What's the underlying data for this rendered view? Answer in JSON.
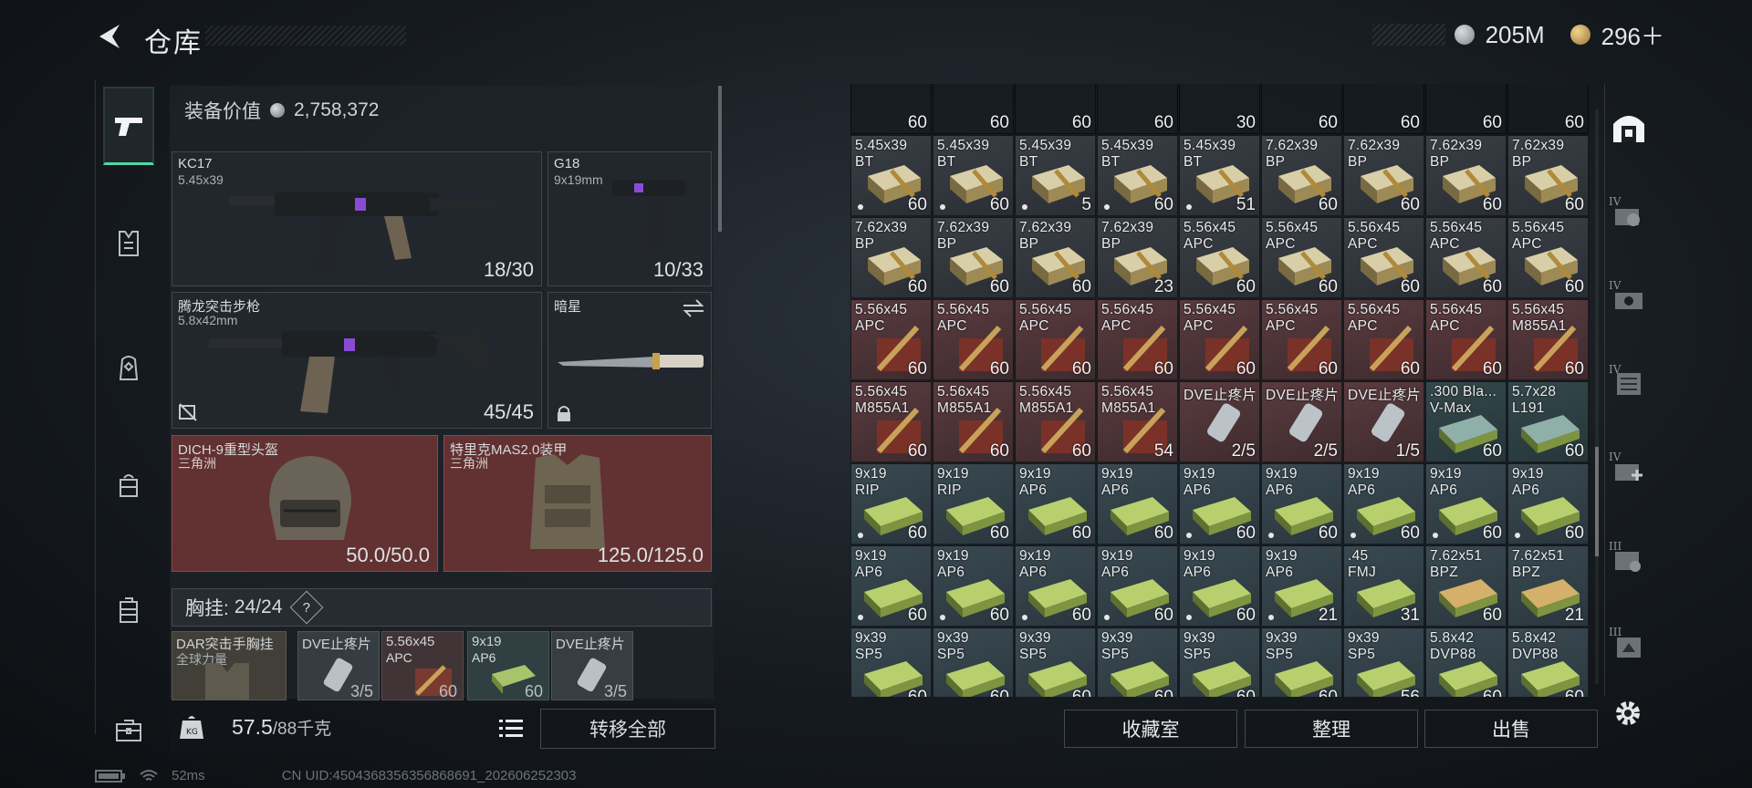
{
  "header": {
    "title": "仓库"
  },
  "currency": {
    "silver": "205M",
    "gold": "296＋",
    "silver_color": "#9aa1a6",
    "gold_color": "#c9a15a"
  },
  "nav": {
    "items": [
      "gun-icon",
      "vest-icon",
      "backpack-icon",
      "bag-icon",
      "case-icon",
      "toolbox-icon"
    ],
    "active_index": 0
  },
  "equipment": {
    "value_label": "装备价值",
    "value": "2,758,372",
    "weapons": [
      {
        "name": "KC17",
        "caliber": "5.45x39",
        "ammo": "18/30"
      },
      {
        "name": "G18",
        "caliber": "9x19mm",
        "ammo": "10/33"
      },
      {
        "name": "腾龙突击步枪",
        "caliber": "5.8x42mm",
        "ammo": "45/45"
      },
      {
        "name": "暗星",
        "caliber": "",
        "ammo": ""
      }
    ],
    "helmet": {
      "name": "DICH-9重型头盔",
      "origin": "三角洲",
      "durability": "50.0/50.0"
    },
    "armor": {
      "name": "特里克MAS2.0装甲",
      "origin": "三角洲",
      "durability": "125.0/125.0"
    },
    "chest_rig": {
      "label": "胸挂:",
      "capacity": "24/24",
      "help": "?"
    },
    "rig_slots": [
      {
        "name": "DAR突击手胸挂",
        "sub": "全球力量",
        "count": ""
      },
      {
        "name": "DVE止疼片",
        "sub": "",
        "count": "3/5"
      },
      {
        "name": "5.56x45",
        "sub": "APC",
        "count": "60"
      },
      {
        "name": "9x19",
        "sub": "AP6",
        "count": "60"
      },
      {
        "name": "DVE止疼片",
        "sub": "",
        "count": "3/5"
      }
    ],
    "weight": "57.5",
    "weight_max": "/88千克",
    "transfer_all": "转移全部"
  },
  "stash": {
    "top_row_counts": [
      "60",
      "60",
      "60",
      "60",
      "30",
      "60",
      "60",
      "60",
      "60"
    ],
    "rows": [
      [
        [
          "5.45x39",
          "BT",
          "60",
          "dark",
          true
        ],
        [
          "5.45x39",
          "BT",
          "60",
          "dark",
          true
        ],
        [
          "5.45x39",
          "BT",
          "5",
          "dark",
          true
        ],
        [
          "5.45x39",
          "BT",
          "60",
          "dark",
          true
        ],
        [
          "5.45x39",
          "BT",
          "51",
          "dark",
          true
        ],
        [
          "7.62x39",
          "BP",
          "60",
          "dark",
          false
        ],
        [
          "7.62x39",
          "BP",
          "60",
          "dark",
          false
        ],
        [
          "7.62x39",
          "BP",
          "60",
          "dark",
          false
        ],
        [
          "7.62x39",
          "BP",
          "60",
          "dark",
          false
        ]
      ],
      [
        [
          "7.62x39",
          "BP",
          "60",
          "dark",
          false
        ],
        [
          "7.62x39",
          "BP",
          "60",
          "dark",
          false
        ],
        [
          "7.62x39",
          "BP",
          "60",
          "dark",
          false
        ],
        [
          "7.62x39",
          "BP",
          "23",
          "dark",
          false
        ],
        [
          "5.56x45",
          "APC",
          "60",
          "dark",
          false
        ],
        [
          "5.56x45",
          "APC",
          "60",
          "dark",
          false
        ],
        [
          "5.56x45",
          "APC",
          "60",
          "dark",
          false
        ],
        [
          "5.56x45",
          "APC",
          "60",
          "dark",
          false
        ],
        [
          "5.56x45",
          "APC",
          "60",
          "dark",
          false
        ]
      ],
      [
        [
          "5.56x45",
          "APC",
          "60",
          "red",
          false
        ],
        [
          "5.56x45",
          "APC",
          "60",
          "red",
          false
        ],
        [
          "5.56x45",
          "APC",
          "60",
          "red",
          false
        ],
        [
          "5.56x45",
          "APC",
          "60",
          "red",
          false
        ],
        [
          "5.56x45",
          "APC",
          "60",
          "red",
          false
        ],
        [
          "5.56x45",
          "APC",
          "60",
          "red",
          false
        ],
        [
          "5.56x45",
          "APC",
          "60",
          "red",
          false
        ],
        [
          "5.56x45",
          "APC",
          "60",
          "red",
          false
        ],
        [
          "5.56x45",
          "M855A1",
          "60",
          "red",
          false
        ]
      ],
      [
        [
          "5.56x45",
          "M855A1",
          "60",
          "red",
          false
        ],
        [
          "5.56x45",
          "M855A1",
          "60",
          "red",
          false
        ],
        [
          "5.56x45",
          "M855A1",
          "60",
          "red",
          false
        ],
        [
          "5.56x45",
          "M855A1",
          "54",
          "red",
          false
        ],
        [
          "DVE止疼片",
          "",
          "2/5",
          "red",
          false
        ],
        [
          "DVE止疼片",
          "",
          "2/5",
          "red",
          false
        ],
        [
          "DVE止疼片",
          "",
          "1/5",
          "red",
          false
        ],
        [
          ".300 Bla...",
          "V-Max",
          "60",
          "teal",
          false
        ],
        [
          "5.7x28",
          "L191",
          "60",
          "teal",
          false
        ]
      ],
      [
        [
          "9x19",
          "RIP",
          "60",
          "green",
          true
        ],
        [
          "9x19",
          "RIP",
          "60",
          "green",
          false
        ],
        [
          "9x19",
          "AP6",
          "60",
          "green",
          false
        ],
        [
          "9x19",
          "AP6",
          "60",
          "green",
          false
        ],
        [
          "9x19",
          "AP6",
          "60",
          "green",
          true
        ],
        [
          "9x19",
          "AP6",
          "60",
          "green",
          true
        ],
        [
          "9x19",
          "AP6",
          "60",
          "green",
          true
        ],
        [
          "9x19",
          "AP6",
          "60",
          "green",
          true
        ],
        [
          "9x19",
          "AP6",
          "60",
          "green",
          true
        ]
      ],
      [
        [
          "9x19",
          "AP6",
          "60",
          "green",
          true
        ],
        [
          "9x19",
          "AP6",
          "60",
          "green",
          true
        ],
        [
          "9x19",
          "AP6",
          "60",
          "green",
          true
        ],
        [
          "9x19",
          "AP6",
          "60",
          "green",
          true
        ],
        [
          "9x19",
          "AP6",
          "60",
          "green",
          true
        ],
        [
          "9x19",
          "AP6",
          "21",
          "green",
          true
        ],
        [
          ".45",
          "FMJ",
          "31",
          "green",
          false
        ],
        [
          "7.62x51",
          "BPZ",
          "60",
          "green",
          false
        ],
        [
          "7.62x51",
          "BPZ",
          "21",
          "green",
          false
        ]
      ],
      [
        [
          "9x39",
          "SP5",
          "60",
          "green",
          false
        ],
        [
          "9x39",
          "SP5",
          "60",
          "green",
          false
        ],
        [
          "9x39",
          "SP5",
          "60",
          "green",
          false
        ],
        [
          "9x39",
          "SP5",
          "60",
          "green",
          false
        ],
        [
          "9x39",
          "SP5",
          "60",
          "green",
          false
        ],
        [
          "9x39",
          "SP5",
          "60",
          "green",
          false
        ],
        [
          "9x39",
          "SP5",
          "56",
          "green",
          false
        ],
        [
          "5.8x42",
          "DVP88",
          "60",
          "green",
          true
        ],
        [
          "5.8x42",
          "DVP88",
          "60",
          "green",
          true
        ]
      ]
    ],
    "buttons": {
      "collection": "收藏室",
      "sort": "整理",
      "sell": "出售"
    }
  },
  "right_bar": {
    "tiers": [
      "IV",
      "IV",
      "IV",
      "IV",
      "III",
      "III"
    ]
  },
  "status": {
    "ping": "52ms",
    "uid": "CN UID:4504368356356868691_202606252303"
  }
}
